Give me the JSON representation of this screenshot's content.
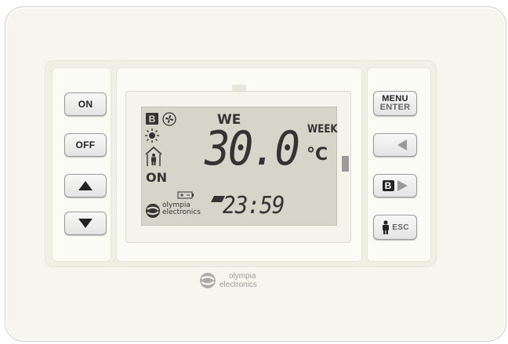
{
  "buttons": {
    "on": "ON",
    "off": "OFF",
    "menu_line1": "MENU",
    "menu_line2": "ENTER",
    "esc": "ESC",
    "b_letter": "B",
    "icons": [
      "up-arrow-icon",
      "down-arrow-icon",
      "moon-left-arrow-icon",
      "b-right-arrow-icon",
      "person-esc-icon"
    ]
  },
  "display": {
    "day": "WE",
    "mode": "WEEK",
    "temperature": "30.0",
    "unit": "°C",
    "status": "ON",
    "time": "23:59",
    "boost_letter": "B",
    "brand_line1": "olympia",
    "brand_line2": "electronics"
  },
  "footer": {
    "brand_line1": "olympia",
    "brand_line2": "electronics"
  },
  "colors": {
    "lcd_background": "#d6d5ca",
    "lcd_segments": "#333333",
    "device_body": "#f7f6ee"
  }
}
